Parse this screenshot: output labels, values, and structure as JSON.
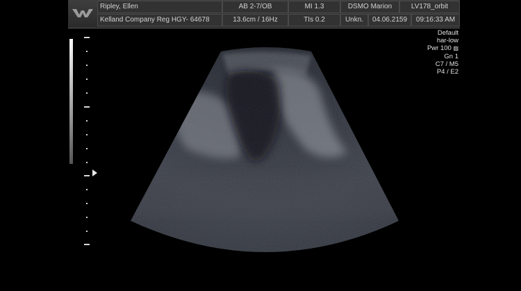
{
  "header": {
    "patient_name": "Ripley, Ellen",
    "exam_type": "AB 2-7/OB",
    "mi": "MI  1.3",
    "operator": "DSMO Marion",
    "study_id": "LV178_orbit",
    "institution": "Kelland Company  Reg HGY- 64678",
    "depth_freq": "13.6cm / 16Hz",
    "tis": "TIs 0.2",
    "unknown": "Unkn.",
    "date": "04.06.2159",
    "time": "09:16:33 AM"
  },
  "settings": {
    "preset": "Default",
    "harmonic": "har-low",
    "power": "Pwr 100",
    "gain": "Gn  1",
    "compound": "C7 / M5",
    "persist": "P4 / E2"
  },
  "icons": {
    "logo": "wy-logo-icon",
    "lock": "lock-icon",
    "focus": "focus-marker-icon"
  },
  "colors": {
    "background": "#000000",
    "header": "#323232",
    "text": "#d2d2d2"
  }
}
